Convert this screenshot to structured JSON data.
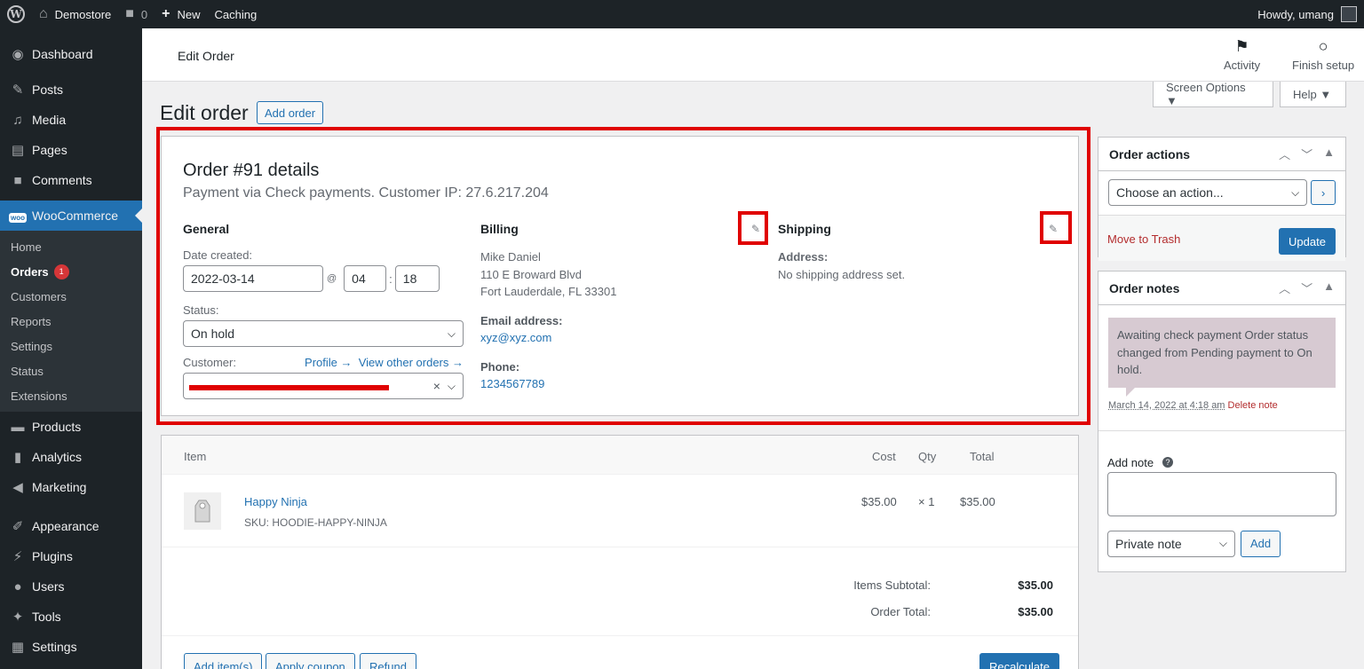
{
  "adminbar": {
    "site_name": "Demostore",
    "comments_count": "0",
    "new_label": "New",
    "caching_label": "Caching",
    "howdy": "Howdy, umang"
  },
  "sidebar": {
    "items_top": [
      {
        "label": "Dashboard",
        "icon": "dashboard-icon"
      },
      {
        "label": "Posts",
        "icon": "pin-icon"
      },
      {
        "label": "Media",
        "icon": "media-icon"
      },
      {
        "label": "Pages",
        "icon": "pages-icon"
      },
      {
        "label": "Comments",
        "icon": "comment-icon"
      }
    ],
    "woocommerce": "WooCommerce",
    "woo_badge": "woo",
    "submenu": [
      "Home",
      "Orders",
      "Customers",
      "Reports",
      "Settings",
      "Status",
      "Extensions"
    ],
    "orders_count": "1",
    "items_bottom": [
      {
        "label": "Products",
        "icon": "products-icon"
      },
      {
        "label": "Analytics",
        "icon": "analytics-icon"
      },
      {
        "label": "Marketing",
        "icon": "megaphone-icon"
      },
      {
        "label": "Appearance",
        "icon": "brush-icon"
      },
      {
        "label": "Plugins",
        "icon": "plugin-icon"
      },
      {
        "label": "Users",
        "icon": "user-icon"
      },
      {
        "label": "Tools",
        "icon": "wrench-icon"
      },
      {
        "label": "Settings",
        "icon": "settings-icon"
      }
    ]
  },
  "header": {
    "title": "Edit Order",
    "activity": "Activity",
    "finish_setup": "Finish setup",
    "screen_options": "Screen Options ▼",
    "help": "Help ▼"
  },
  "page": {
    "title": "Edit order",
    "add_order": "Add order"
  },
  "order": {
    "heading": "Order #91 details",
    "payment_line": "Payment via Check payments. Customer IP: 27.6.217.204",
    "general": {
      "heading": "General",
      "date_label": "Date created:",
      "date": "2022-03-14",
      "at": "@",
      "hour": "04",
      "colon": ":",
      "minute": "18",
      "status_label": "Status:",
      "status": "On hold",
      "customer_label": "Customer:",
      "profile_link": "Profile →",
      "other_orders_link": "View other orders →",
      "clear": "×"
    },
    "billing": {
      "heading": "Billing",
      "name": "Mike Daniel",
      "street": "110 E Broward Blvd",
      "city": "Fort Lauderdale, FL 33301",
      "email_label": "Email address:",
      "email": "xyz@xyz.com",
      "phone_label": "Phone:",
      "phone": "1234567789"
    },
    "shipping": {
      "heading": "Shipping",
      "address_label": "Address:",
      "address_value": "No shipping address set."
    }
  },
  "items": {
    "headers": {
      "item": "Item",
      "cost": "Cost",
      "qty": "Qty",
      "total": "Total"
    },
    "rows": [
      {
        "name": "Happy Ninja",
        "sku_label": "SKU:",
        "sku": "HOODIE-HAPPY-NINJA",
        "cost": "$35.00",
        "qty": "× 1",
        "total": "$35.00"
      }
    ],
    "subtotal_label": "Items Subtotal:",
    "subtotal": "$35.00",
    "total_label": "Order Total:",
    "total": "$35.00",
    "add_items": "Add item(s)",
    "apply_coupon": "Apply coupon",
    "refund": "Refund",
    "recalculate": "Recalculate"
  },
  "order_actions": {
    "title": "Order actions",
    "select": "Choose an action...",
    "trash": "Move to Trash",
    "update": "Update"
  },
  "order_notes": {
    "title": "Order notes",
    "note_text": "Awaiting check payment Order status changed from Pending payment to On hold.",
    "note_meta": "March 14, 2022 at 4:18 am",
    "delete_note": "Delete note",
    "add_note_label": "Add note",
    "help": "?",
    "note_type": "Private note",
    "add_button": "Add"
  },
  "colors": {
    "accent": "#2271b1",
    "highlight": "#e00000",
    "admin_bar": "#1d2327"
  }
}
